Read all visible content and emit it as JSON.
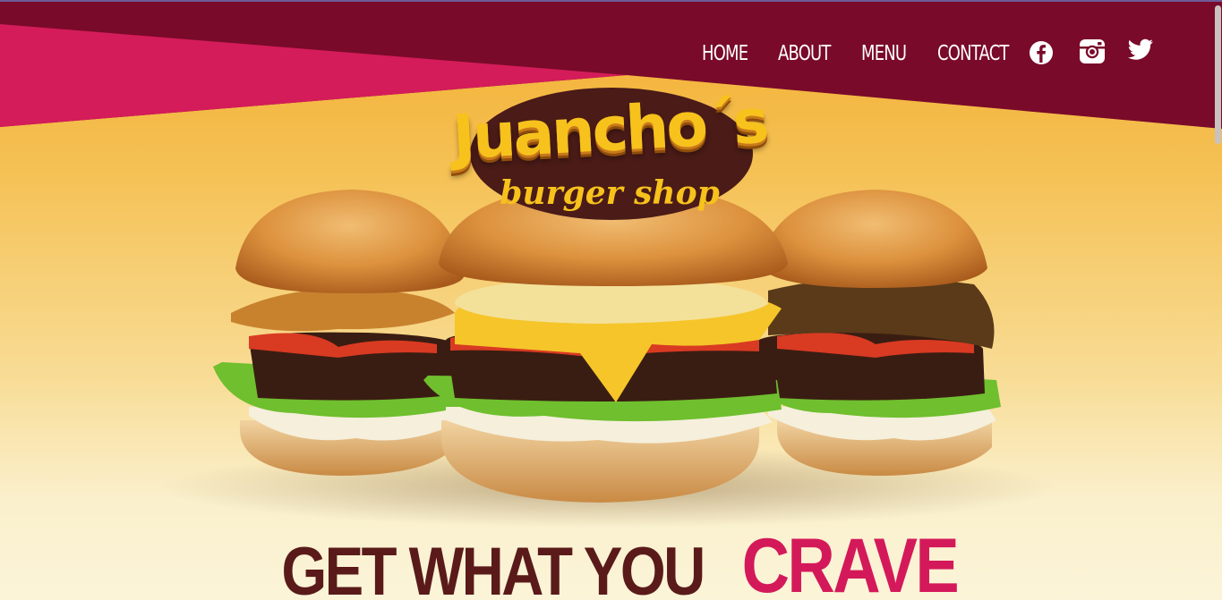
{
  "nav": {
    "items": [
      {
        "label": "HOME"
      },
      {
        "label": "ABOUT"
      },
      {
        "label": "MENU"
      },
      {
        "label": "CONTACT"
      }
    ]
  },
  "social": {
    "icons": [
      "facebook-icon",
      "instagram-icon",
      "twitter-icon"
    ]
  },
  "logo": {
    "name": "Juancho´s",
    "subtitle": "burger shop"
  },
  "hero": {
    "tagline_prefix": "GET WHAT YOU",
    "tagline_emphasis": "CRAVE"
  },
  "colors": {
    "band_dark": "#7a0a2a",
    "band_pink": "#d41c5a",
    "tagline_dark": "#5a1a1a",
    "tagline_accent": "#d4195a",
    "logo_yellow": "#f7c21c",
    "logo_brown": "#4a1b17"
  }
}
